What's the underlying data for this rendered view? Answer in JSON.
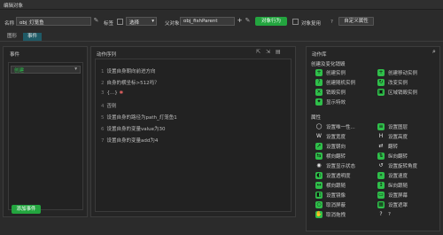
{
  "window": {
    "title": "编辑对象"
  },
  "top": {
    "name_label": "名称",
    "name_value": "obj_灯笼鱼",
    "tag_label": "标签",
    "tag_select": "选择",
    "parent_label": "父对象",
    "parent_value": "obj_fishParent",
    "object_behavior_btn": "对象行为",
    "object_reuse_label": "对象复用",
    "help_glyph": "?",
    "custom_props_btn": "自定义属性"
  },
  "tabs": [
    {
      "label": "图形"
    },
    {
      "label": "事件"
    }
  ],
  "events_panel": {
    "title": "事件",
    "selected_event": "创建",
    "add_event_btn": "添加事件"
  },
  "sequence_panel": {
    "title": "动作序列",
    "rows": [
      {
        "num": "1",
        "text": "设置自身朝向前进方向"
      },
      {
        "num": "2",
        "text": "自身的横坐标>512吗？"
      },
      {
        "num": "3",
        "text": "{...}"
      },
      {
        "num": "4",
        "text": "否则"
      },
      {
        "num": "5",
        "text": "设置自身的路径为path_灯笼鱼1"
      },
      {
        "num": "6",
        "text": "设置自身的变量value为30"
      },
      {
        "num": "7",
        "text": "设置自身的变量add为4"
      }
    ]
  },
  "library": {
    "title": "动作库",
    "create_section": "创建及变化销毁",
    "create_items": [
      {
        "label": "创建实例",
        "icon": "create-instance-icon",
        "cls": "green",
        "glyph": "+"
      },
      {
        "label": "创建移动实例",
        "icon": "create-moving-icon",
        "cls": "green",
        "glyph": "+"
      },
      {
        "label": "创建随机实例",
        "icon": "create-random-icon",
        "cls": "green",
        "glyph": "?"
      },
      {
        "label": "改变实例",
        "icon": "change-instance-icon",
        "cls": "green",
        "glyph": "↻"
      },
      {
        "label": "销毁实例",
        "icon": "destroy-instance-icon",
        "cls": "green",
        "glyph": "×"
      },
      {
        "label": "区域销毁实例",
        "icon": "area-destroy-icon",
        "cls": "green",
        "glyph": "▣"
      },
      {
        "label": "显示特效",
        "icon": "show-effect-icon",
        "cls": "green",
        "glyph": "✦"
      }
    ],
    "props_section": "属性",
    "prop_items": [
      {
        "label": "设置唯一性...",
        "icon": "unique-icon",
        "cls": "white",
        "glyph": "◯"
      },
      {
        "label": "设置图层",
        "icon": "layer-icon",
        "cls": "green",
        "glyph": "≡"
      },
      {
        "label": "设置宽度",
        "icon": "width-icon",
        "cls": "white",
        "glyph": "W"
      },
      {
        "label": "设置高度",
        "icon": "height-icon",
        "cls": "white",
        "glyph": "H"
      },
      {
        "label": "设置朝向",
        "icon": "direction-icon",
        "cls": "green",
        "glyph": "➚"
      },
      {
        "label": "翻转",
        "icon": "flip-icon",
        "cls": "white",
        "glyph": "⇄"
      },
      {
        "label": "横向翻转",
        "icon": "hflip-icon",
        "cls": "green",
        "glyph": "⇆"
      },
      {
        "label": "纵向翻转",
        "icon": "vflip-icon",
        "cls": "green",
        "glyph": "⇅"
      },
      {
        "label": "设置显示状态",
        "icon": "visible-icon",
        "cls": "white",
        "glyph": "◉"
      },
      {
        "label": "设置旋转角度",
        "icon": "rotate-icon",
        "cls": "white",
        "glyph": "↺"
      },
      {
        "label": "设置透明度",
        "icon": "opacity-icon",
        "cls": "green",
        "glyph": "◐"
      },
      {
        "label": "设置速度",
        "icon": "speed-icon",
        "cls": "green",
        "glyph": "»"
      },
      {
        "label": "横向跟随",
        "icon": "hfollow-icon",
        "cls": "green",
        "glyph": "↔"
      },
      {
        "label": "纵向跟随",
        "icon": "vfollow-icon",
        "cls": "green",
        "glyph": "↕"
      },
      {
        "label": "设置镜像",
        "icon": "mirror-icon",
        "cls": "green",
        "glyph": "◧"
      },
      {
        "label": "设置屏幕",
        "icon": "screen-icon",
        "cls": "green",
        "glyph": "▭"
      },
      {
        "label": "取消屏蔽",
        "icon": "unmask-icon",
        "cls": "green",
        "glyph": "○"
      },
      {
        "label": "设置遮罩",
        "icon": "mask-icon",
        "cls": "green",
        "glyph": "▦"
      },
      {
        "label": "取消拖拽",
        "icon": "undrag-icon",
        "cls": "green",
        "glyph": "✋"
      },
      {
        "label": "?",
        "icon": "unknown-icon",
        "cls": "white",
        "glyph": "?"
      }
    ]
  },
  "colors": {
    "accent_green": "#23a53f",
    "tab_active": "#1f5a66"
  }
}
